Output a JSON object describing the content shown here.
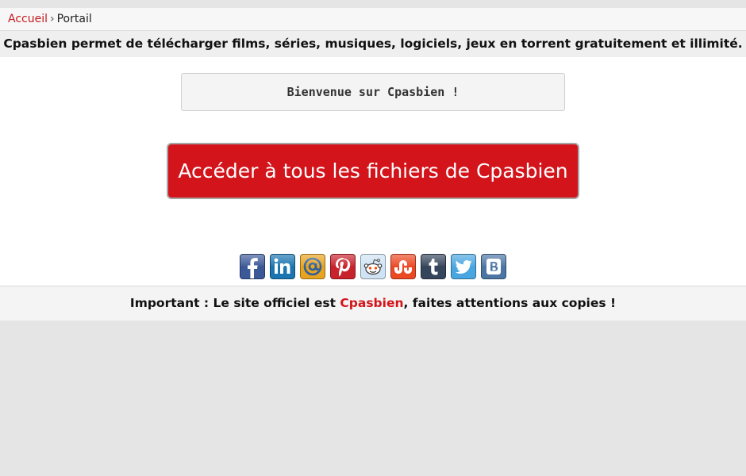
{
  "breadcrumb": {
    "home_label": "Accueil",
    "separator": "›",
    "current_label": "Portail"
  },
  "tagline": "Cpasbien permet de télécharger films, séries, musiques, logiciels, jeux en torrent gratuitement et illimité.",
  "welcome": "Bienvenue sur Cpasbien !",
  "cta": {
    "label": "Accéder à tous les fichiers de Cpasbien",
    "color": "#d3141b"
  },
  "share": {
    "icons": [
      {
        "name": "facebook-icon",
        "color": "#3b5998"
      },
      {
        "name": "linkedin-icon",
        "color": "#1a75b0"
      },
      {
        "name": "email-icon",
        "color": "#3f86c7"
      },
      {
        "name": "pinterest-icon",
        "color": "#c8232c"
      },
      {
        "name": "reddit-icon",
        "color": "#cfe3f5"
      },
      {
        "name": "stumbleupon-icon",
        "color": "#eb4924"
      },
      {
        "name": "tumblr-icon",
        "color": "#35465c"
      },
      {
        "name": "twitter-icon",
        "color": "#4aa6e0"
      },
      {
        "name": "vk-icon",
        "color": "#4c75a3"
      }
    ]
  },
  "footer": {
    "prefix": "Important : Le site officiel est ",
    "brand": "Cpasbien",
    "suffix": ", faites attentions aux copies !"
  },
  "colors": {
    "accent": "#d3141b",
    "link": "#c8191e"
  }
}
